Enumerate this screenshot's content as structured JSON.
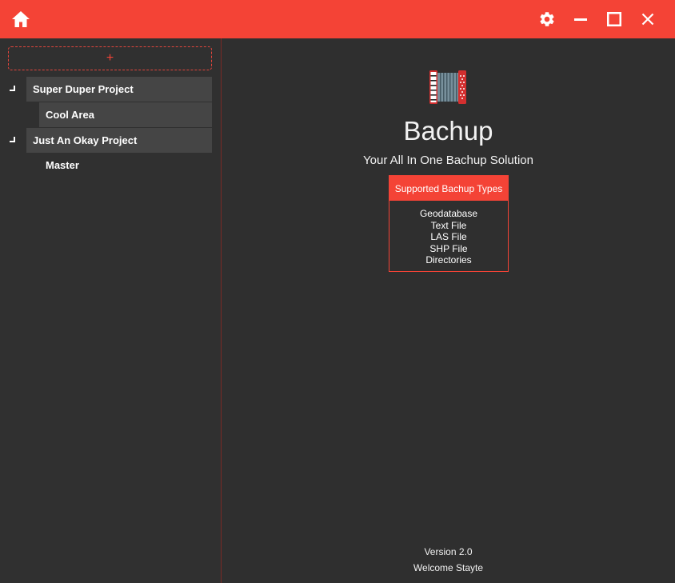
{
  "titlebar": {
    "icons": [
      "home-icon",
      "gear-icon",
      "minimize-icon",
      "maximize-icon",
      "close-icon"
    ],
    "background": "#f44336"
  },
  "sidebar": {
    "add_label": "+",
    "projects": [
      {
        "name": "Super Duper Project",
        "expanded": true,
        "children": [
          "Cool Area"
        ]
      },
      {
        "name": "Just An Okay Project",
        "expanded": true,
        "children": [
          "Master"
        ]
      }
    ]
  },
  "main": {
    "logo_icon": "accordion-icon",
    "app_name": "Bachup",
    "tagline": "Your All In One Bachup Solution",
    "types_header": "Supported Bachup Types",
    "types": [
      "Geodatabase",
      "Text File",
      "LAS File",
      "SHP File",
      "Directories"
    ],
    "version": "Version 2.0",
    "welcome": "Welcome Stayte"
  },
  "colors": {
    "accent": "#f44336",
    "background": "#2f2f2f",
    "node_background": "#454545"
  }
}
